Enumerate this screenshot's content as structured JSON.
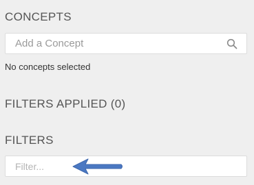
{
  "concepts": {
    "heading": "CONCEPTS",
    "search_placeholder": "Add a Concept",
    "search_value": "",
    "search_icon": "search-icon",
    "status": "No concepts selected"
  },
  "filters_applied": {
    "heading": "FILTERS APPLIED (0)",
    "count": 0
  },
  "filters": {
    "heading": "FILTERS",
    "input_placeholder": "Filter...",
    "input_value": ""
  },
  "annotation": {
    "icon": "arrow-left-icon",
    "color": "#4a78c2"
  },
  "colors": {
    "background": "#efefef",
    "heading_text": "#555555",
    "input_border": "#dcdcdc",
    "arrow": "#4a78c2"
  }
}
